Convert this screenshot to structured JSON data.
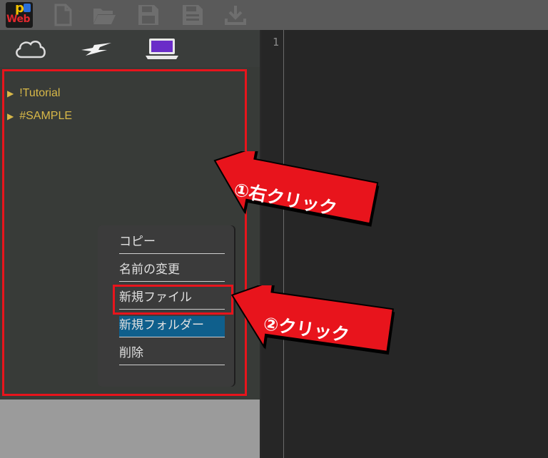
{
  "app": {
    "logo_letter": "p",
    "logo_text": "Web"
  },
  "toolbar": {
    "icons": [
      "new-file-icon",
      "open-folder-icon",
      "save-icon",
      "save-as-icon",
      "download-icon"
    ]
  },
  "tabs": [
    "cloud-icon",
    "lightning-icon",
    "laptop-icon"
  ],
  "file_tree": {
    "items": [
      {
        "label": "!Tutorial"
      },
      {
        "label": "#SAMPLE"
      }
    ]
  },
  "context_menu": {
    "items": [
      {
        "label": "コピー"
      },
      {
        "label": "名前の変更"
      },
      {
        "label": "新規ファイル"
      },
      {
        "label": "新規フォルダー"
      },
      {
        "label": "削除"
      }
    ],
    "highlighted_index": 3
  },
  "editor": {
    "line_number": "1"
  },
  "annotations": {
    "step1": "①右クリック",
    "step2": "②クリック"
  },
  "colors": {
    "highlight_red": "#e8141c",
    "folder_text": "#d8b848",
    "menu_active": "#0f5f8c"
  }
}
